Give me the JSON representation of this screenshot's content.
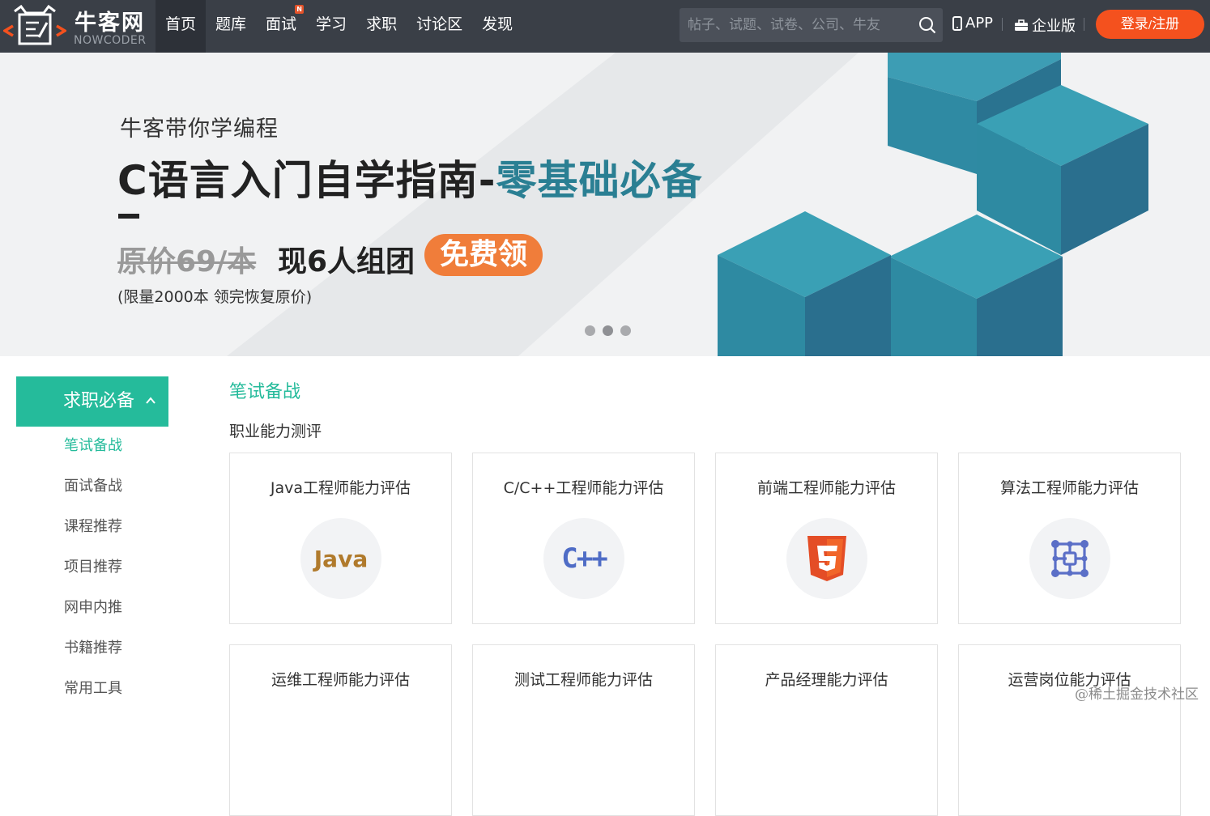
{
  "brand": {
    "name_cn": "牛客网",
    "name_en": "NOWCODER"
  },
  "nav": {
    "items": [
      {
        "label": "首页",
        "active": true
      },
      {
        "label": "题库"
      },
      {
        "label": "面试",
        "badge": "N"
      },
      {
        "label": "学习"
      },
      {
        "label": "求职"
      },
      {
        "label": "讨论区"
      },
      {
        "label": "发现"
      }
    ],
    "search_placeholder": "帖子、试题、试卷、公司、牛友",
    "app_label": "APP",
    "enterprise_label": "企业版",
    "login_label": "登录",
    "login_slash": "/",
    "register_label": "注册"
  },
  "banner": {
    "subtitle": "牛客带你学编程",
    "title_main": "C语言入门自学指南-",
    "title_accent": "零基础必备",
    "old_price": "原价69/本",
    "now_offer": "现6人组团",
    "free_label": "免费领",
    "note": "(限量2000本 领完恢复原价)",
    "carousel": {
      "count": 3,
      "active": 1
    }
  },
  "sidebar": {
    "header": "求职必备",
    "items": [
      {
        "label": "笔试备战",
        "active": true
      },
      {
        "label": "面试备战"
      },
      {
        "label": "课程推荐"
      },
      {
        "label": "项目推荐"
      },
      {
        "label": "网申内推"
      },
      {
        "label": "书籍推荐"
      },
      {
        "label": "常用工具"
      }
    ]
  },
  "main": {
    "section_title": "笔试备战",
    "subsection_title": "职业能力测评",
    "cards": [
      {
        "title": "Java工程师能力评估",
        "icon": "java-icon",
        "icon_text": "Java"
      },
      {
        "title": "C/C++工程师能力评估",
        "icon": "cpp-icon",
        "icon_text": "C++"
      },
      {
        "title": "前端工程师能力评估",
        "icon": "html5-icon"
      },
      {
        "title": "算法工程师能力评估",
        "icon": "algorithm-icon"
      },
      {
        "title": "运维工程师能力评估"
      },
      {
        "title": "测试工程师能力评估"
      },
      {
        "title": "产品经理能力评估"
      },
      {
        "title": "运营岗位能力评估"
      }
    ]
  },
  "watermark": "@稀土掘金技术社区",
  "colors": {
    "nav_bg": "#3a3f47",
    "accent_green": "#25bb9b",
    "login_orange": "#f4511e",
    "banner_teal": "#2a7f93",
    "free_orange": "#f07d3a"
  }
}
